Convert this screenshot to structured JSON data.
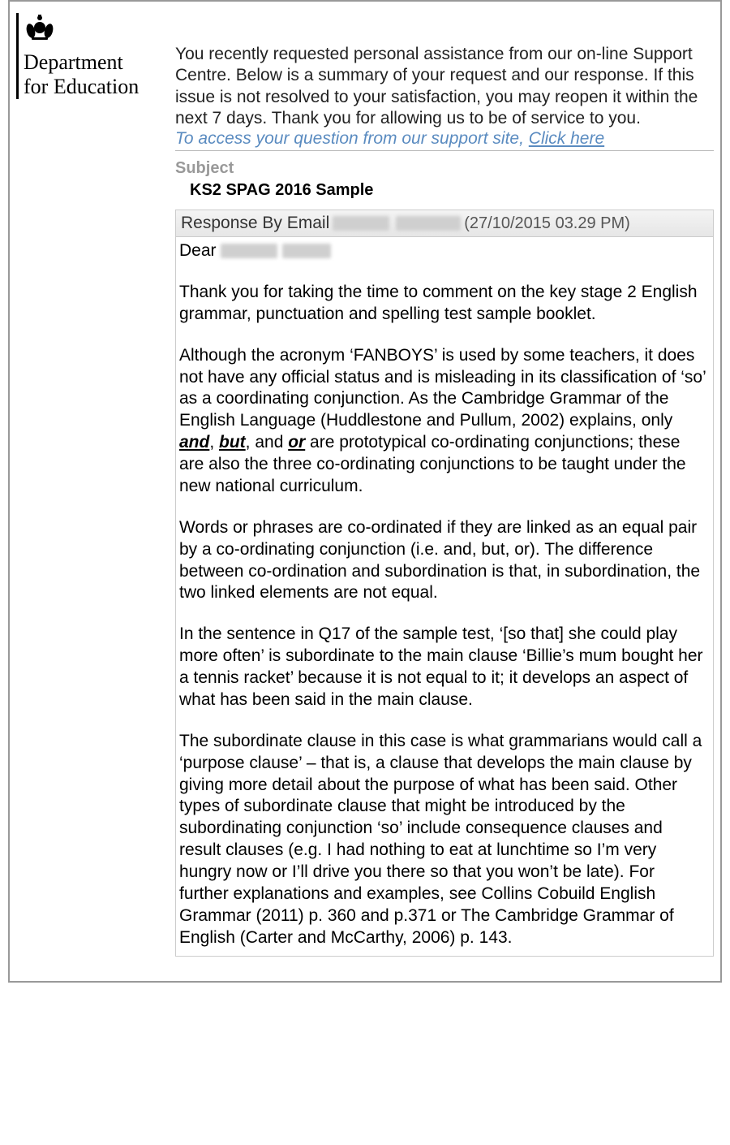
{
  "logo": {
    "dept_line1": "Department",
    "dept_line2": "for Education"
  },
  "intro": "You recently requested personal assistance from our on-line Support Centre. Below is a summary of your request and our response. If this issue is not resolved to your satisfaction, you may reopen it within the next 7 days. Thank you for allowing us to be of service to you.",
  "access_prefix": "To access your question from our support site, ",
  "access_link": "Click here",
  "subject_label": "Subject",
  "subject_value": "KS2 SPAG 2016 Sample",
  "response": {
    "prefix": "Response By Email",
    "timestamp": "(27/10/2015 03.29 PM)"
  },
  "body": {
    "dear": "Dear",
    "p1": "Thank you for taking the time to comment on the key stage 2 English grammar, punctuation and spelling test sample booklet.",
    "p2_a": "Although the acronym ‘FANBOYS’ is used by some teachers, it does not have any official status and is misleading in its classification of ‘so’ as a coordinating conjunction. As the Cambridge Grammar of the English Language (Huddlestone and Pullum, 2002) explains, only ",
    "p2_and": "and",
    "p2_c1": ", ",
    "p2_but": "but",
    "p2_c2": ", and ",
    "p2_or": "or",
    "p2_b": " are prototypical co-ordinating conjunctions; these are also the three co-ordinating conjunctions to be taught under the new national curriculum.",
    "p3": "Words or phrases are co-ordinated if they are linked as an equal pair by a co-ordinating conjunction (i.e. and, but, or). The difference between co-ordination and subordination is that, in subordination, the two linked elements are not equal.",
    "p4": "In the sentence in Q17 of the sample test, ‘[so that] she could play more often’ is subordinate to the main clause ‘Billie’s mum bought her a tennis racket’ because it is not equal to it; it develops an aspect of what has been said in the main clause.",
    "p5": "The subordinate clause in this case is what grammarians would call a ‘purpose clause’ – that is, a clause that develops the main clause by giving more detail about the purpose of what has been said. Other types of subordinate clause that might be introduced by the subordinating conjunction ‘so’ include consequence clauses and result clauses (e.g. I had nothing to eat at lunchtime so I’m very hungry now or I’ll drive you there so that you won’t be late). For further explanations and examples, see Collins Cobuild English Grammar (2011) p. 360 and p.371 or The Cambridge Grammar of English (Carter and McCarthy, 2006) p. 143."
  }
}
